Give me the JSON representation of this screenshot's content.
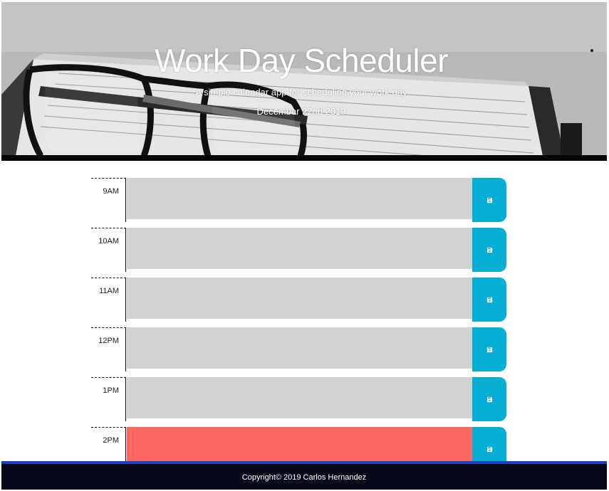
{
  "header": {
    "title": "Work Day Scheduler",
    "subtitle": "A simple calendar app for scheduling your work day",
    "current_date": "December 22nd 2019"
  },
  "timeblocks": [
    {
      "hour": "9AM",
      "status": "past",
      "text": ""
    },
    {
      "hour": "10AM",
      "status": "past",
      "text": ""
    },
    {
      "hour": "11AM",
      "status": "past",
      "text": ""
    },
    {
      "hour": "12PM",
      "status": "past",
      "text": ""
    },
    {
      "hour": "1PM",
      "status": "past",
      "text": ""
    },
    {
      "hour": "2PM",
      "status": "present",
      "text": ""
    }
  ],
  "save_button_icon": "save-icon",
  "colors": {
    "past": "#d3d3d3",
    "present": "#ff6961",
    "save_button": "#06aed5",
    "footer_bg": "#050816",
    "footer_border": "#1a3fbf"
  },
  "footer": {
    "copyright": "Copyright© 2019 Carlos Hernandez"
  }
}
